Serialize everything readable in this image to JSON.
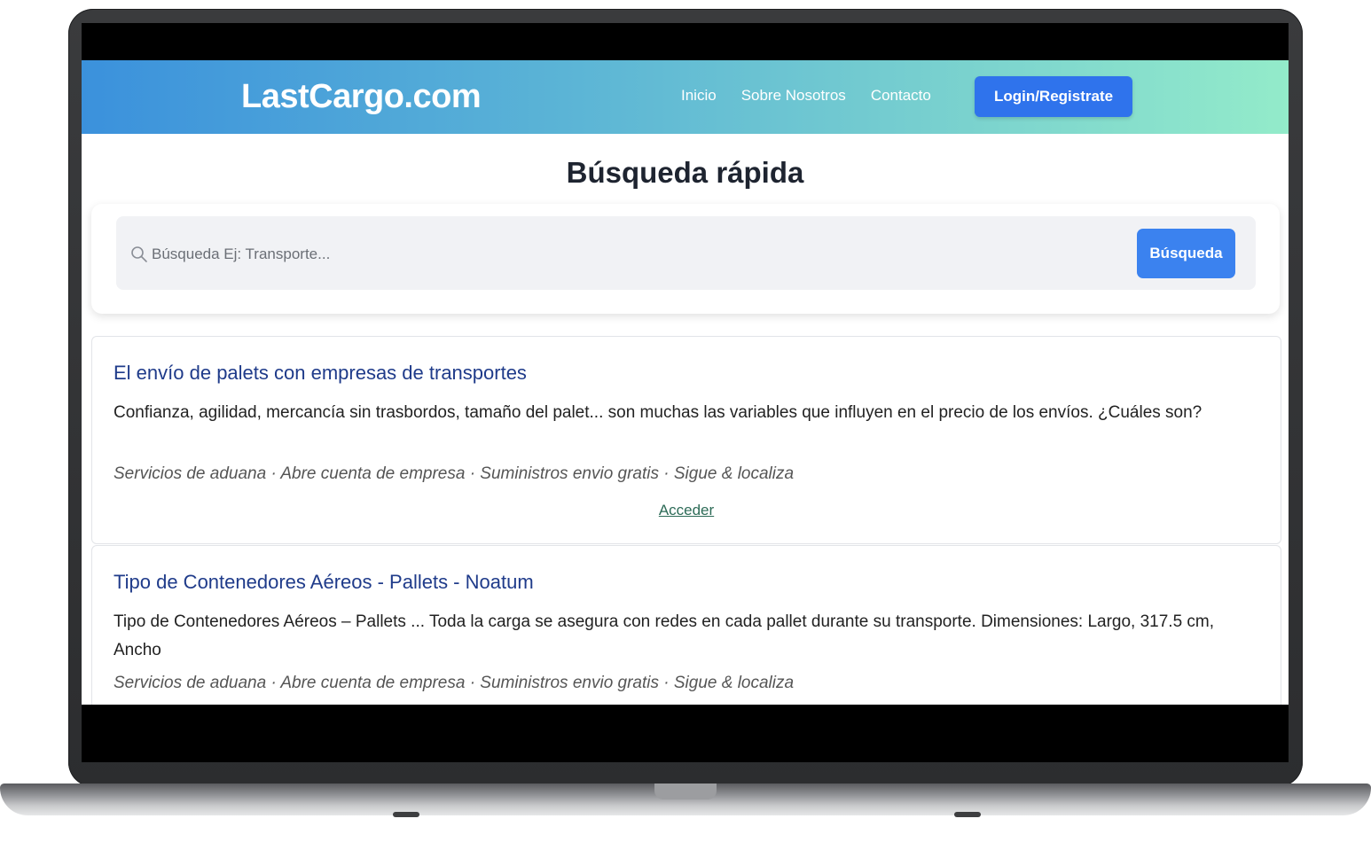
{
  "header": {
    "brand": "LastCargo.com",
    "nav": [
      "Inicio",
      "Sobre Nosotros",
      "Contacto"
    ],
    "login_label": "Login/Registrate"
  },
  "search": {
    "title": "Búsqueda rápida",
    "placeholder": "Búsqueda Ej: Transporte...",
    "button_label": "Búsqueda"
  },
  "results": [
    {
      "title": "El envío de palets con empresas de transportes",
      "description": "Confianza, agilidad, mercancía sin trasbordos, tamaño del palet... son muchas las variables que influyen en el precio de los envíos. ¿Cuáles son?",
      "tags": "Servicios de aduana · Abre cuenta de empresa · Suministros envio gratis · Sigue & localiza",
      "link": "Acceder"
    },
    {
      "title": "Tipo de Contenedores Aéreos - Pallets - Noatum",
      "description": "Tipo de Contenedores Aéreos – Pallets ... Toda la carga se asegura con redes en cada pallet durante su transporte. Dimensiones: Largo, 317.5 cm, Ancho",
      "tags": "Servicios de aduana · Abre cuenta de empresa · Suministros envio gratis · Sigue & localiza"
    }
  ]
}
